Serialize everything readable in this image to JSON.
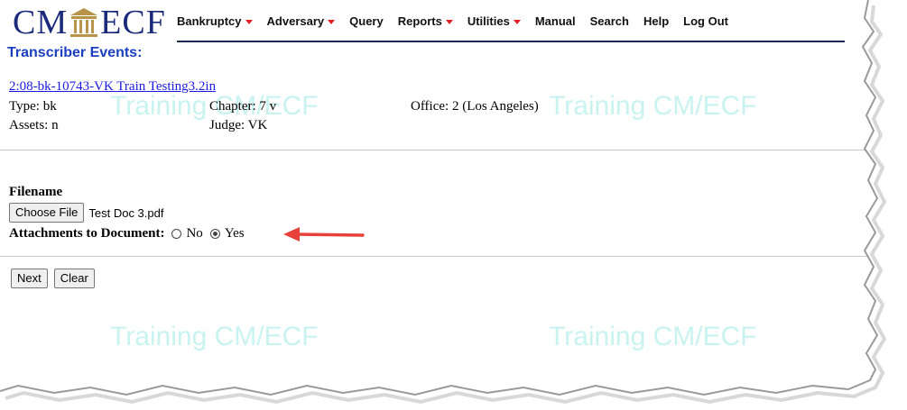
{
  "watermark": "Training CM/ECF",
  "logo": {
    "left_text": "CM",
    "right_text": "ECF"
  },
  "nav": [
    {
      "label": "Bankruptcy",
      "dropdown": true
    },
    {
      "label": "Adversary",
      "dropdown": true
    },
    {
      "label": "Query",
      "dropdown": false
    },
    {
      "label": "Reports",
      "dropdown": true
    },
    {
      "label": "Utilities",
      "dropdown": true
    },
    {
      "label": "Manual",
      "dropdown": false
    },
    {
      "label": "Search",
      "dropdown": false
    },
    {
      "label": "Help",
      "dropdown": false
    },
    {
      "label": "Log Out",
      "dropdown": false
    }
  ],
  "page_title": "Transcriber Events:",
  "case": {
    "link": "2:08-bk-10743-VK Train Testing3.2in",
    "type": "Type: bk",
    "assets": "Assets: n",
    "chapter": "Chapter: 7 v",
    "judge": "Judge: VK",
    "office": "Office: 2 (Los Angeles)"
  },
  "form": {
    "filename_label": "Filename",
    "choose_file_label": "Choose File",
    "file_name": "Test Doc 3.pdf",
    "attachments_label": "Attachments to Document:",
    "option_no": "No",
    "option_yes": "Yes",
    "selected": "Yes"
  },
  "buttons": {
    "next": "Next",
    "clear": "Clear"
  },
  "colors": {
    "title": "#1a3fc0",
    "logo": "#1b2a7a",
    "caret": "#e02020",
    "arrow": "#e8403a",
    "watermark": "#c9f3f0"
  }
}
